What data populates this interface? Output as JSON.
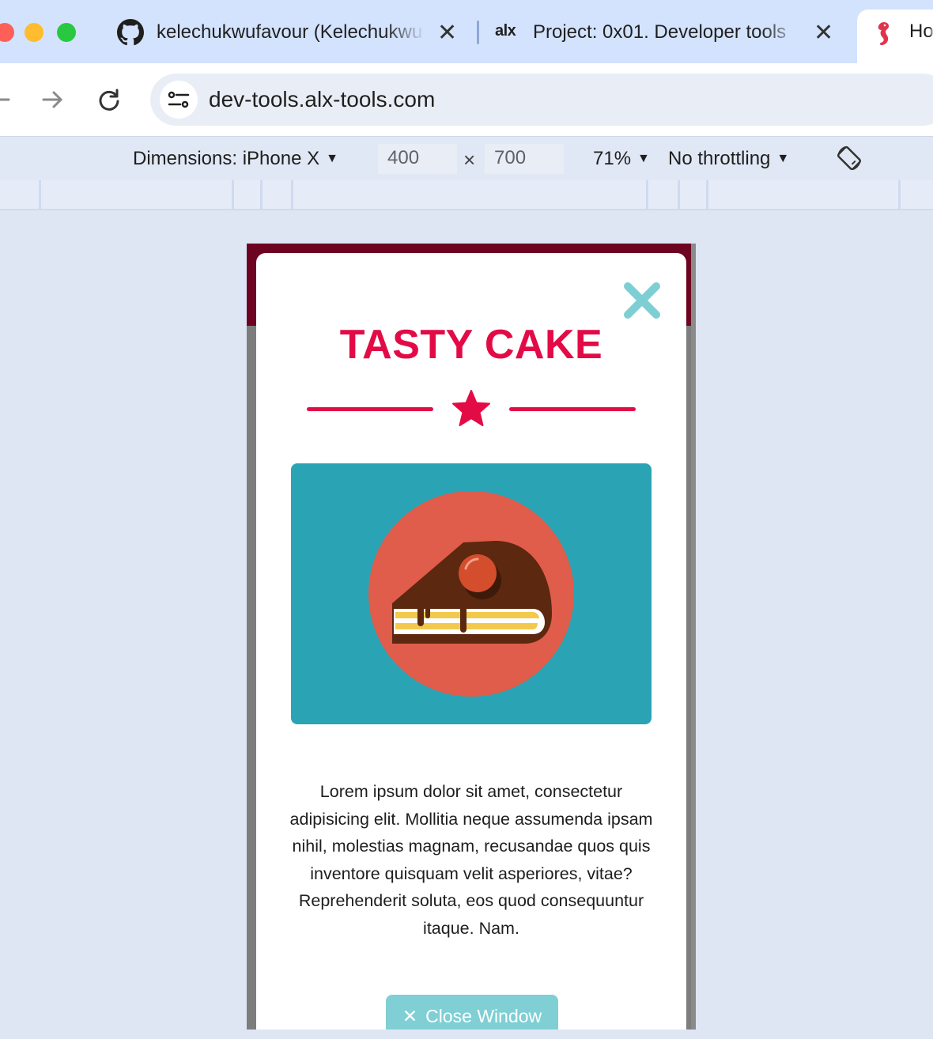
{
  "browser": {
    "tabs": [
      {
        "title": "kelechukwufavour (Kelechukwu",
        "icon": "github-icon"
      },
      {
        "title": "Project: 0x01. Developer tools",
        "icon": "alx-logo"
      },
      {
        "title": "Ho",
        "icon": "seahorse-icon",
        "active": true
      }
    ],
    "alx_logo_text": "alx",
    "url": "dev-tools.alx-tools.com"
  },
  "device_toolbar": {
    "dimensions_label": "Dimensions: iPhone X",
    "width": "400",
    "height": "700",
    "times": "×",
    "zoom": "71%",
    "throttling": "No throttling"
  },
  "modal": {
    "title": "TASTY CAKE",
    "body": "Lorem ipsum dolor sit amet, consectetur adipisicing elit. Mollitia neque assumenda ipsam nihil, molestias magnam, recusandae quos quis inventore quisquam velit asperiores, vitae? Reprehenderit soluta, eos quod consequuntur itaque. Nam.",
    "button_icon": "✕",
    "button_label": "Close Window"
  },
  "colors": {
    "brand_red": "#e30b46",
    "close_teal": "#7ecfd4",
    "hero_teal": "#2aa4b4",
    "plate_coral": "#e05c4b",
    "chocolate": "#5c2810"
  }
}
